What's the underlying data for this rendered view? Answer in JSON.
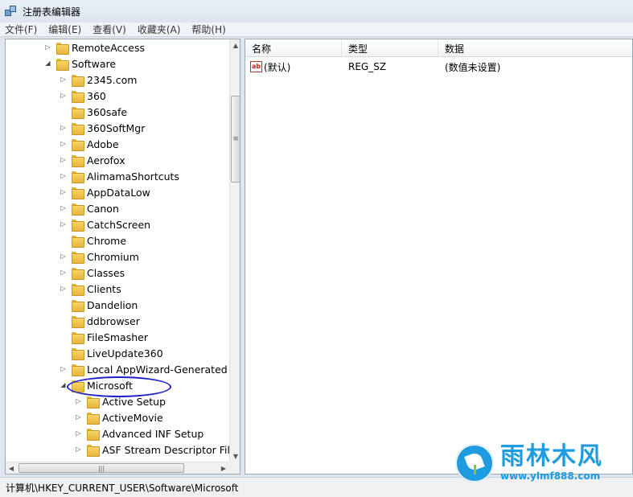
{
  "window": {
    "title": "注册表编辑器"
  },
  "menu": [
    {
      "id": "file",
      "label": "文件(F)"
    },
    {
      "id": "edit",
      "label": "编辑(E)"
    },
    {
      "id": "view",
      "label": "查看(V)"
    },
    {
      "id": "favorites",
      "label": "收藏夹(A)"
    },
    {
      "id": "help",
      "label": "帮助(H)"
    }
  ],
  "tree": {
    "items": [
      {
        "label": "RemoteAccess",
        "level": 0,
        "expander": "collapsed"
      },
      {
        "label": "Software",
        "level": 0,
        "expander": "expanded"
      },
      {
        "label": "2345.com",
        "level": 1,
        "expander": "collapsed"
      },
      {
        "label": "360",
        "level": 1,
        "expander": "collapsed"
      },
      {
        "label": "360safe",
        "level": 1,
        "expander": "none"
      },
      {
        "label": "360SoftMgr",
        "level": 1,
        "expander": "collapsed"
      },
      {
        "label": "Adobe",
        "level": 1,
        "expander": "collapsed"
      },
      {
        "label": "Aerofox",
        "level": 1,
        "expander": "collapsed"
      },
      {
        "label": "AlimamaShortcuts",
        "level": 1,
        "expander": "collapsed"
      },
      {
        "label": "AppDataLow",
        "level": 1,
        "expander": "collapsed"
      },
      {
        "label": "Canon",
        "level": 1,
        "expander": "collapsed"
      },
      {
        "label": "CatchScreen",
        "level": 1,
        "expander": "collapsed"
      },
      {
        "label": "Chrome",
        "level": 1,
        "expander": "none"
      },
      {
        "label": "Chromium",
        "level": 1,
        "expander": "collapsed"
      },
      {
        "label": "Classes",
        "level": 1,
        "expander": "collapsed"
      },
      {
        "label": "Clients",
        "level": 1,
        "expander": "collapsed"
      },
      {
        "label": "Dandelion",
        "level": 1,
        "expander": "none"
      },
      {
        "label": "ddbrowser",
        "level": 1,
        "expander": "none"
      },
      {
        "label": "FileSmasher",
        "level": 1,
        "expander": "none"
      },
      {
        "label": "LiveUpdate360",
        "level": 1,
        "expander": "none"
      },
      {
        "label": "Local AppWizard-Generated A",
        "level": 1,
        "expander": "collapsed"
      },
      {
        "label": "Microsoft",
        "level": 1,
        "expander": "expanded"
      },
      {
        "label": "Active Setup",
        "level": 2,
        "expander": "collapsed"
      },
      {
        "label": "ActiveMovie",
        "level": 2,
        "expander": "collapsed"
      },
      {
        "label": "Advanced INF Setup",
        "level": 2,
        "expander": "collapsed"
      },
      {
        "label": "ASF Stream Descriptor File",
        "level": 2,
        "expander": "collapsed"
      }
    ]
  },
  "list": {
    "columns": [
      "名称",
      "类型",
      "数据"
    ],
    "rows": [
      {
        "name": "(默认)",
        "type": "REG_SZ",
        "data": "(数值未设置)",
        "icon": "string-value-icon"
      }
    ]
  },
  "status": {
    "path": "计算机\\HKEY_CURRENT_USER\\Software\\Microsoft"
  },
  "watermark": {
    "name": "雨林木风",
    "url": "www.ylmf888.com"
  },
  "colors": {
    "highlight_ellipse": "#1d22c8",
    "watermark": "#1f9be0"
  }
}
